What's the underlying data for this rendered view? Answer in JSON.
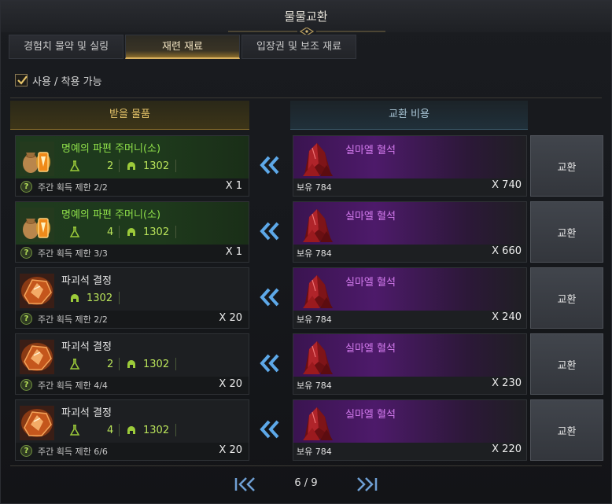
{
  "window": {
    "title": "물물교환"
  },
  "tabs": [
    {
      "label": "경험치 물약 및 실링",
      "active": false
    },
    {
      "label": "재련 재료",
      "active": true
    },
    {
      "label": "입장권 및 보조 재료",
      "active": false
    }
  ],
  "filter": {
    "label": "사용 / 착용 가능",
    "checked": true
  },
  "headers": {
    "receive": "받을 물품",
    "cost": "교환 비용"
  },
  "rows": [
    {
      "item_name": "명예의 파편 주머니(소)",
      "name_color": "green",
      "icon": "honor-shard-pouch-icon",
      "stat1": "2",
      "stat2": "1302",
      "limit": "주간 획득 제한 2/2",
      "qty": "X 1",
      "cost_name": "실마엘 혈석",
      "own": "보유 784",
      "cost_qty": "X 740",
      "button": "교환"
    },
    {
      "item_name": "명예의 파편 주머니(소)",
      "name_color": "green",
      "icon": "honor-shard-pouch-icon",
      "stat1": "4",
      "stat2": "1302",
      "limit": "주간 획득 제한 3/3",
      "qty": "X 1",
      "cost_name": "실마엘 혈석",
      "own": "보유 784",
      "cost_qty": "X 660",
      "button": "교환"
    },
    {
      "item_name": "파괴석 결정",
      "name_color": "white",
      "icon": "destruction-stone-crystal-icon",
      "stat1": "",
      "stat2": "1302",
      "limit": "주간 획득 제한 2/2",
      "qty": "X 20",
      "cost_name": "실마엘 혈석",
      "own": "보유 784",
      "cost_qty": "X 240",
      "button": "교환"
    },
    {
      "item_name": "파괴석 결정",
      "name_color": "white",
      "icon": "destruction-stone-crystal-icon",
      "stat1": "2",
      "stat2": "1302",
      "limit": "주간 획득 제한 4/4",
      "qty": "X 20",
      "cost_name": "실마엘 혈석",
      "own": "보유 784",
      "cost_qty": "X 230",
      "button": "교환"
    },
    {
      "item_name": "파괴석 결정",
      "name_color": "white",
      "icon": "destruction-stone-crystal-icon",
      "stat1": "4",
      "stat2": "1302",
      "limit": "주간 획득 제한 6/6",
      "qty": "X 20",
      "cost_name": "실마엘 혈석",
      "own": "보유 784",
      "cost_qty": "X 220",
      "button": "교환"
    }
  ],
  "pager": {
    "text": "6 / 9"
  },
  "colors": {
    "accent_gold": "#e7c56a",
    "item_green": "#8fe04a",
    "cost_purple": "#d47bef",
    "stat_green": "#b9e35a"
  }
}
